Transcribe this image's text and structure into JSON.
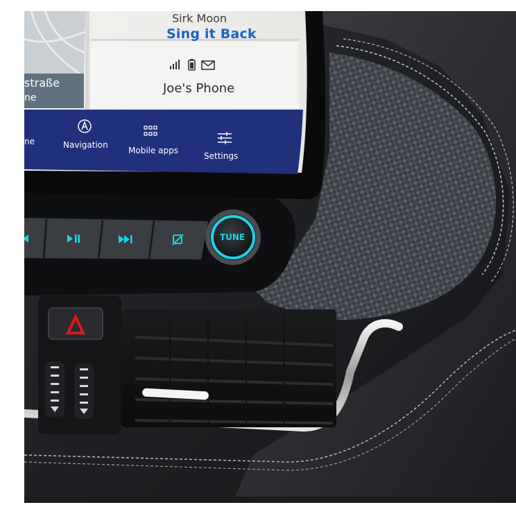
{
  "colors": {
    "accent_cyan": "#19d6e6",
    "screen_blue_bar": "#20307a",
    "song_blue": "#1a63c6",
    "hazard_red": "#e01818"
  },
  "screen": {
    "media": {
      "previous_line": "Sirk Moon",
      "song_title": "Sing it Back"
    },
    "phone": {
      "name": "Joe's Phone",
      "icons": [
        "signal-icon",
        "battery-icon",
        "envelope-icon"
      ]
    },
    "map": {
      "street_name": "straße",
      "street_fragment": "ne"
    },
    "nav_bar": {
      "items": [
        {
          "label": "ne",
          "icon": ""
        },
        {
          "label": "Navigation",
          "icon": "compass-a-icon"
        },
        {
          "label": "Mobile apps",
          "icon": "grid-icon"
        },
        {
          "label": "Settings",
          "icon": "sliders-icon"
        }
      ]
    }
  },
  "controls": {
    "tune_knob": "TUNE",
    "buttons": [
      "play-pause-icon",
      "skip-forward-icon",
      "mute-icon"
    ],
    "hazard_button": "hazard-triangle-icon"
  }
}
